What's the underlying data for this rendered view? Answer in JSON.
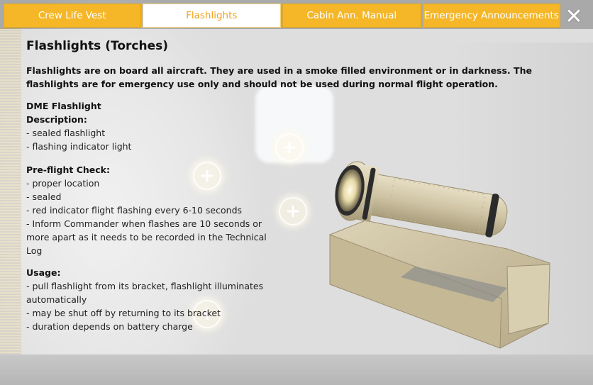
{
  "tabs": [
    {
      "label": "Crew Life Vest",
      "active": false
    },
    {
      "label": "Flashlights",
      "active": true
    },
    {
      "label": "Cabin Ann. Manual",
      "active": false
    },
    {
      "label": "Emergency Announcements",
      "active": false
    }
  ],
  "close_label": "✕",
  "hotspot_label": "+",
  "content": {
    "title": "Flashlights (Torches)",
    "intro": "Flashlights are on board all aircraft. They are used in a smoke filled environment or in darkness. The flashlights are for emergency use only and should not be used during normal flight operation.",
    "item_name": "DME Flashlight",
    "description": {
      "heading": "Description:",
      "lines": [
        "- sealed flashlight",
        "- flashing indicator light"
      ]
    },
    "preflight": {
      "heading": "Pre-flight Check:",
      "lines": [
        "- proper location",
        "- sealed",
        "- red indicator flight flashing every 6-10 seconds",
        "- Inform Commander when flashes are 10 seconds or more apart as it needs to be recorded in the Technical Log"
      ]
    },
    "usage": {
      "heading": "Usage:",
      "lines": [
        "- pull flashlight from its bracket, flashlight illuminates automatically",
        "- may be shut off by returning to its bracket",
        "- duration depends on battery charge"
      ]
    }
  },
  "colors": {
    "tab": "#f5b728",
    "tab_active_text": "#f0a21e",
    "flashlight_body": "#d3c9ab"
  }
}
